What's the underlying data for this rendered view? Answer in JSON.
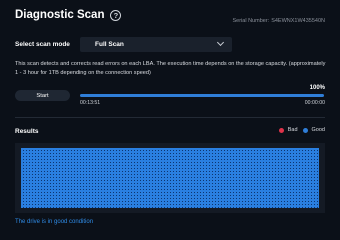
{
  "header": {
    "title": "Diagnostic Scan",
    "help_icon": "help-circle-icon",
    "serial_label": "Serial Number:",
    "serial_value": "S4EWNX1W435540N"
  },
  "scan_mode": {
    "label": "Select scan mode",
    "selected": "Full Scan",
    "dropdown_icon": "chevron-down-icon"
  },
  "description": "This scan detects and corrects read errors on each LBA. The execution time depends on the storage capacity. (approximately 1 - 3 hour for 1TB depending on the connection speed)",
  "controls": {
    "start_label": "Start"
  },
  "progress": {
    "percent_label": "100%",
    "fraction": 1.0,
    "elapsed": "00:13:51",
    "remaining": "00:00:00"
  },
  "results": {
    "label": "Results",
    "legend": [
      {
        "label": "Bad",
        "color": "#e0334a"
      },
      {
        "label": "Good",
        "color": "#2f7ed8"
      }
    ],
    "status": "The drive is in good condition"
  },
  "colors": {
    "accent": "#2f7ed8",
    "background": "#0b1018"
  }
}
